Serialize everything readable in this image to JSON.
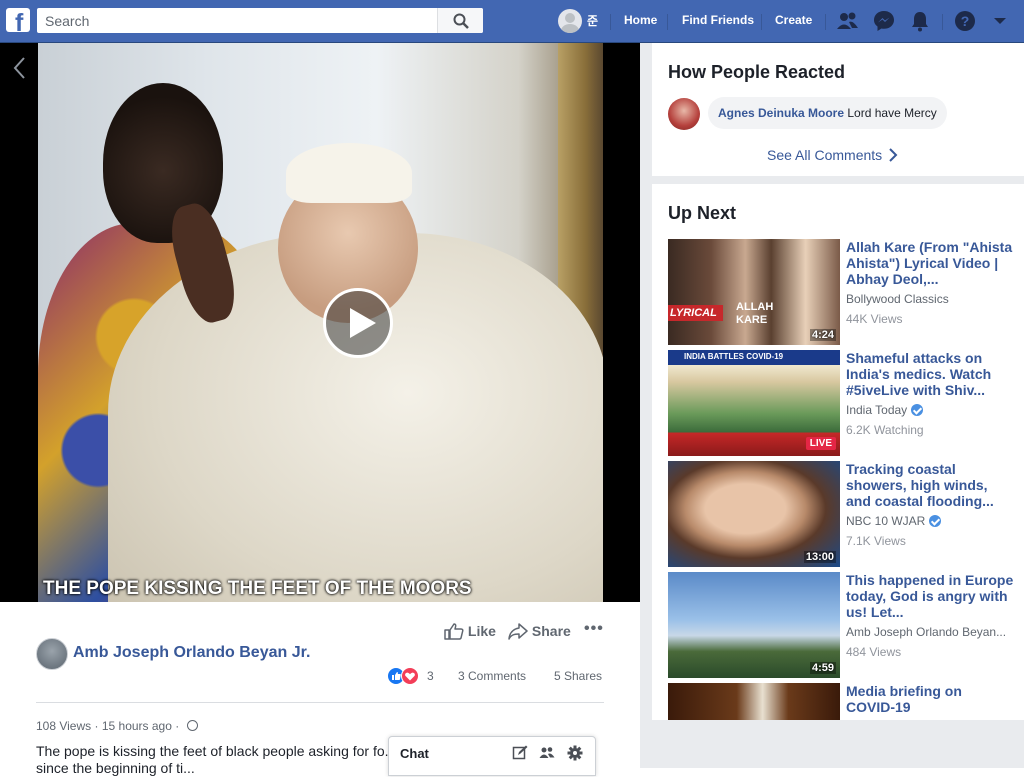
{
  "search": {
    "placeholder": "Search"
  },
  "profile": {
    "name": "준"
  },
  "nav": {
    "home": "Home",
    "find_friends": "Find Friends",
    "create": "Create"
  },
  "video": {
    "caption": "THE POPE KISSING THE FEET OF THE MOORS"
  },
  "post": {
    "author": "Amb Joseph Orlando Beyan Jr.",
    "like_label": "Like",
    "share_label": "Share",
    "reaction_count": "3",
    "comments": "3 Comments",
    "shares": "5 Shares",
    "views": "108 Views",
    "separator": "·",
    "time": "15 hours ago",
    "description": "The pope is kissing the feet of black people asking for fo... they gave done to black people since the beginning of ti..."
  },
  "chat": {
    "label": "Chat"
  },
  "how_people_reacted": {
    "title": "How People Reacted",
    "comment_author": "Agnes Deinuka Moore",
    "comment_text": "Lord have Mercy",
    "see_all": "See All Comments"
  },
  "up_next": {
    "title": "Up Next",
    "items": [
      {
        "title": "Allah Kare (From \"Ahista Ahista\") Lyrical Video | Abhay Deol,...",
        "source": "Bollywood Classics",
        "views": "44K Views",
        "duration": "4:24"
      },
      {
        "title": "Shameful attacks on India's medics. Watch #5iveLive with Shiv...",
        "source": "India Today",
        "views": "6.2K Watching",
        "badge": "LIVE"
      },
      {
        "title": "Tracking coastal showers, high winds, and coastal flooding...",
        "source": "NBC 10 WJAR",
        "views": "7.1K Views",
        "duration": "13:00"
      },
      {
        "title": "This happened in Europe today, God is angry with us! Let...",
        "source": "Amb Joseph Orlando Beyan...",
        "views": "484 Views",
        "duration": "4:59"
      },
      {
        "title": "Media briefing on COVID-19",
        "source": "",
        "views": ""
      }
    ]
  },
  "colors": {
    "brand": "#4267b2",
    "link": "#385898",
    "live": "#e42645"
  }
}
